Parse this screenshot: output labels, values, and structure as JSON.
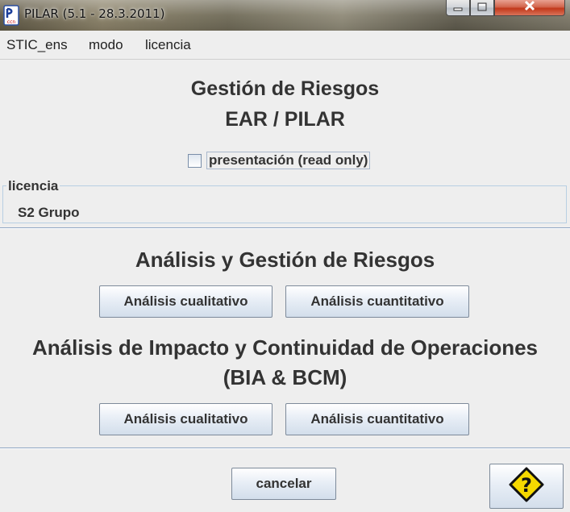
{
  "window": {
    "title": "PILAR (5.1 - 28.3.2011)",
    "app_icon": "pilar-ccn-icon"
  },
  "menubar": {
    "items": [
      "STIC_ens",
      "modo",
      "licencia"
    ]
  },
  "header": {
    "title_line1": "Gestión de Riesgos",
    "title_line2": "EAR / PILAR"
  },
  "presentation": {
    "label": "presentación (read only)",
    "checked": false
  },
  "license": {
    "legend": "licencia",
    "value": "S2 Grupo"
  },
  "risk_section": {
    "title": "Análisis y Gestión de Riesgos",
    "qualitative_label": "Análisis cualitativo",
    "quantitative_label": "Análisis cuantitativo"
  },
  "bia_section": {
    "title_line1": "Análisis de Impacto y Continuidad de Operaciones",
    "title_line2": "(BIA & BCM)",
    "qualitative_label": "Análisis cualitativo",
    "quantitative_label": "Análisis cuantitativo"
  },
  "footer": {
    "cancel_label": "cancelar",
    "help_icon": "help-diamond-icon"
  },
  "colors": {
    "background": "#eeeeee",
    "help_yellow": "#f5d800",
    "separator": "#8fa6c3"
  }
}
